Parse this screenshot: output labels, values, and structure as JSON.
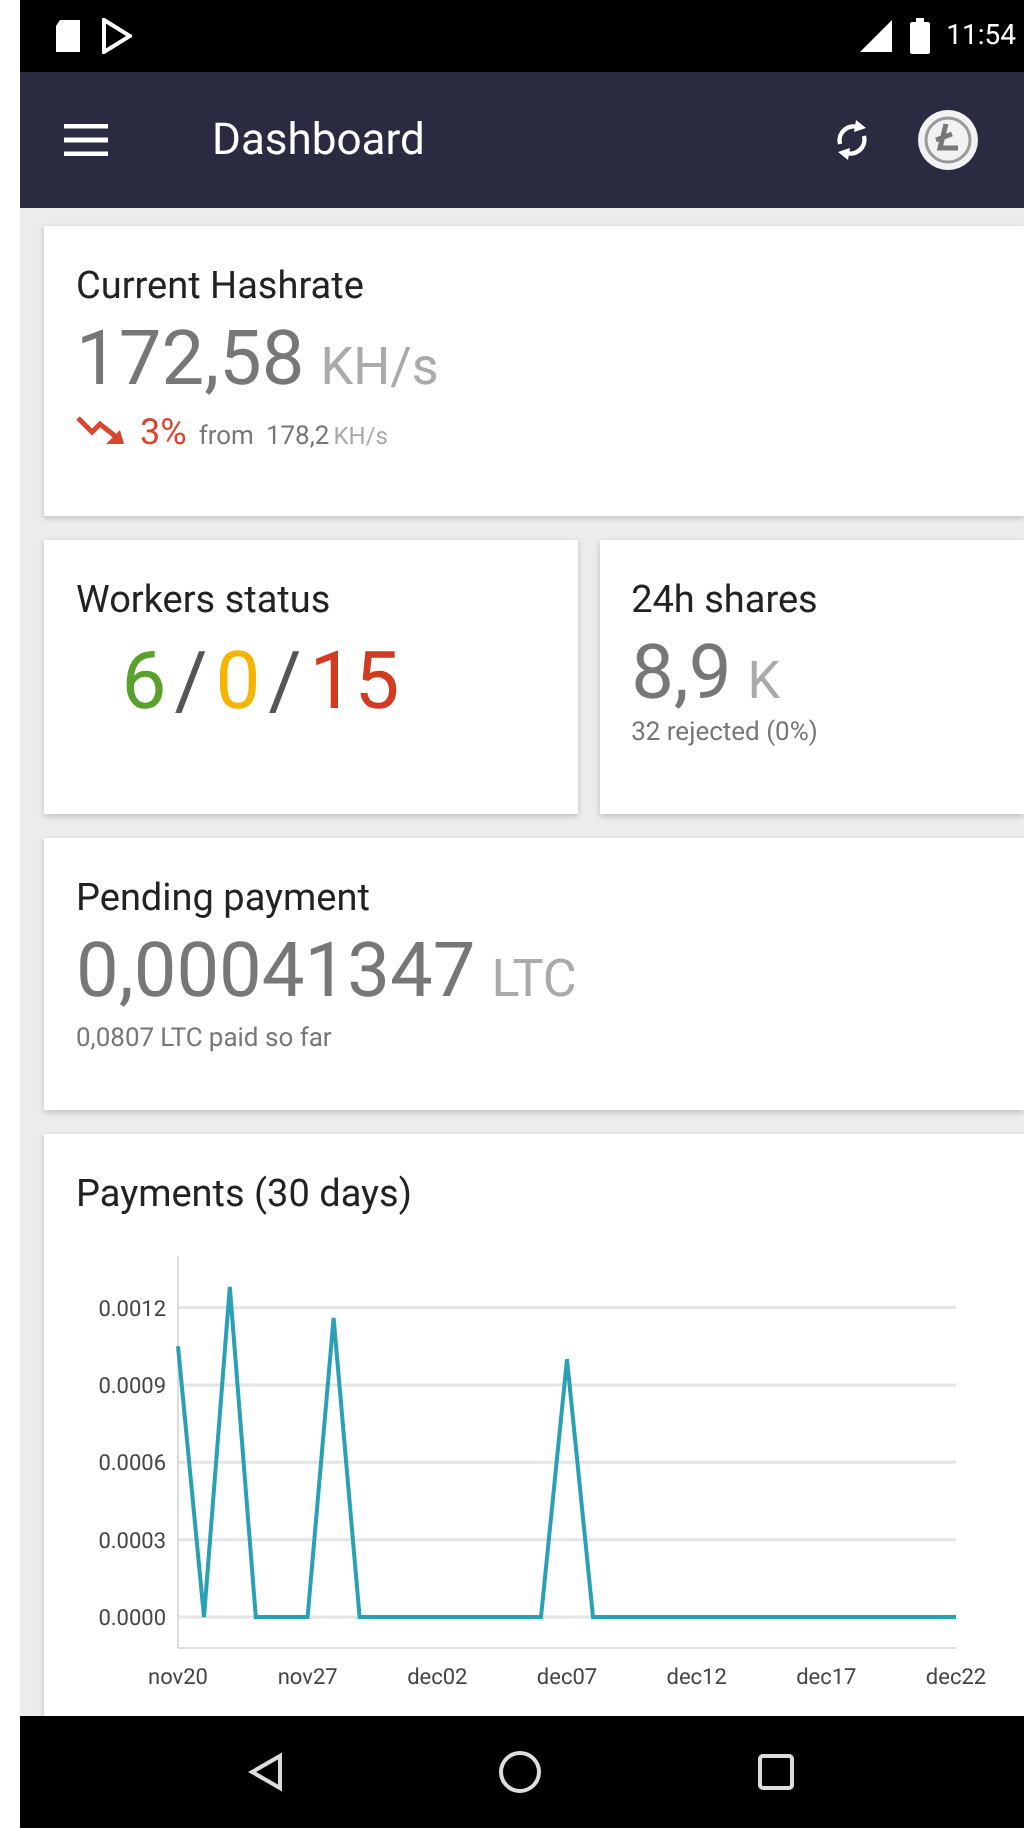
{
  "status_bar": {
    "time": "11:54"
  },
  "app_bar": {
    "title": "Dashboard"
  },
  "hashrate": {
    "title": "Current Hashrate",
    "value": "172,58",
    "unit": "KH/s",
    "change": "3%",
    "from_label": "from",
    "from_value": "178,2",
    "from_unit": "KH/s"
  },
  "workers": {
    "title": "Workers status",
    "separator": "/",
    "counts": [
      {
        "value": "6",
        "color": "#5aa12b"
      },
      {
        "value": "0",
        "color": "#f5b400"
      },
      {
        "value": "15",
        "color": "#d23a21"
      }
    ]
  },
  "shares": {
    "title": "24h shares",
    "value": "8,9",
    "unit": "K",
    "note": "32 rejected (0%)"
  },
  "pending": {
    "title": "Pending payment",
    "value": "0,00041347",
    "unit": "LTC",
    "paid_value": "0,0807",
    "paid_unit": "LTC",
    "paid_text": "paid so far"
  },
  "payments": {
    "title": "Payments (30 days)",
    "chart_data": {
      "type": "line",
      "categories": [
        "nov20",
        null,
        null,
        null,
        null,
        "nov27",
        null,
        null,
        null,
        null,
        "dec02",
        null,
        null,
        null,
        null,
        "dec07",
        null,
        null,
        null,
        null,
        "dec12",
        null,
        null,
        null,
        null,
        "dec17",
        null,
        null,
        null,
        null,
        "dec22"
      ],
      "series": [
        {
          "color": "#2aa0b5",
          "values": [
            0.00105,
            0,
            0.00128,
            0,
            0,
            0,
            0.00116,
            0,
            0,
            0,
            0,
            0,
            0,
            0,
            0,
            0.001,
            0,
            0,
            0,
            0,
            0,
            0,
            0,
            0,
            0,
            0,
            0,
            0,
            0,
            0,
            0
          ]
        }
      ],
      "ylim": [
        -0.00012,
        0.0014
      ],
      "grid": true,
      "yticks": [
        {
          "value": 0,
          "label": "0.0000"
        },
        {
          "value": 0.0003,
          "label": "0.0003"
        },
        {
          "value": 0.0006,
          "label": "0.0006"
        },
        {
          "value": 0.0009,
          "label": "0.0009"
        },
        {
          "value": 0.0012,
          "label": "0.0012"
        }
      ]
    }
  }
}
